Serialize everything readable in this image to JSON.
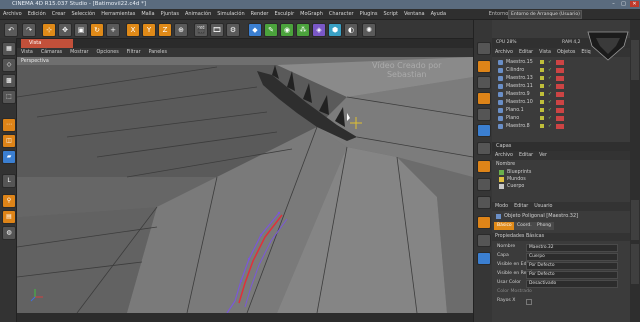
{
  "window": {
    "title": "CINEMA 4D R15.037 Studio - [Batimovil22.c4d *]",
    "min_label": "–",
    "max_label": "□",
    "close_label": "✕"
  },
  "menubar": {
    "items": [
      "Archivo",
      "Edición",
      "Crear",
      "Selección",
      "Herramientas",
      "Malla",
      "Pjuntas",
      "Animación",
      "Simulación",
      "Render",
      "Esculpir",
      "MoGraph",
      "Character",
      "Plugins",
      "Script",
      "Ventana",
      "Ayuda"
    ],
    "entorno_label": "Entorno:",
    "entorno_value": "Entorno de Arranque (Usuario)"
  },
  "toolbar": {
    "x_label": "X",
    "y_label": "Y",
    "z_label": "Z"
  },
  "viewport": {
    "tab_label": "Vista",
    "menu": [
      "Vista",
      "Cámaras",
      "Mostrar",
      "Opciones",
      "Filtrar",
      "Paneles"
    ],
    "camera_label": "Perspectiva",
    "watermark_line1": "Vídeo Creado por",
    "watermark_line2": "Sebastian"
  },
  "objects": {
    "menu": [
      "Archivo",
      "Editar",
      "Vista",
      "Objetos",
      "Etiq"
    ],
    "cpu_label": "CPU 28%",
    "ram_label": "RAM 4,2",
    "rows": [
      {
        "name": "Maestro.15"
      },
      {
        "name": "Cilindro"
      },
      {
        "name": "Maestro.13"
      },
      {
        "name": "Maestro.11"
      },
      {
        "name": "Maestro.9"
      },
      {
        "name": "Maestro.10"
      },
      {
        "name": "Plano.1"
      },
      {
        "name": "Plano"
      },
      {
        "name": "Maestro.8"
      }
    ]
  },
  "layers": {
    "title": "Capas",
    "menu": [
      "Archivo",
      "Editar",
      "Ver"
    ],
    "col_name": "Nombre",
    "rows": [
      {
        "name": "Blueprints",
        "color": "#6ab04c"
      },
      {
        "name": "Mundos",
        "color": "#e0c040"
      },
      {
        "name": "Cuerpo",
        "color": "#c8c8c8"
      }
    ]
  },
  "attributes": {
    "menu": [
      "Modo",
      "Editar",
      "Usuario"
    ],
    "object_label": "Objeto Poligonal [Maestro.32]",
    "tabs": [
      "Básico",
      "Coord.",
      "Phong"
    ],
    "props_title": "Propiedades Básicas",
    "rows": [
      {
        "label": "Nombre",
        "value": "Maestro.32"
      },
      {
        "label": "Capa",
        "value": "Cuerpo"
      },
      {
        "label": "Visible en Editor",
        "value": "Por Defecto"
      },
      {
        "label": "Visible en Render",
        "value": "Por Defecto"
      },
      {
        "label": "Usar Color",
        "value": "Desactivado"
      },
      {
        "label": "Color Mostrado",
        "value": ""
      },
      {
        "label": "Rayos X",
        "value": ""
      }
    ]
  },
  "colors": {
    "accent": "#e08a18",
    "viewport_bg": "#737373",
    "selection_edge": "#7a58d8",
    "highlight_edge": "#e0303a"
  }
}
